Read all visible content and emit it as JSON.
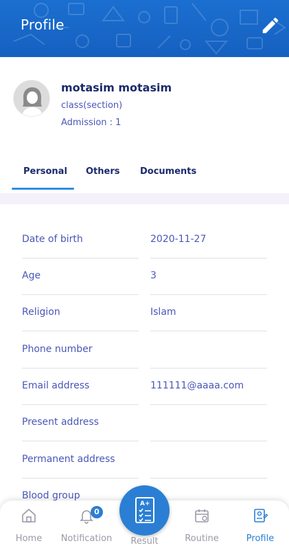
{
  "header": {
    "title": "Profile",
    "edit_icon": "pencil-icon"
  },
  "profile": {
    "name": "motasim motasim",
    "class_section": "class(section)",
    "admission": "Admission : 1"
  },
  "tabs": [
    {
      "label": "Personal",
      "active": true
    },
    {
      "label": "Others",
      "active": false
    },
    {
      "label": "Documents",
      "active": false
    }
  ],
  "details": [
    {
      "label": "Date of birth",
      "value": "2020-11-27"
    },
    {
      "label": "Age",
      "value": "3"
    },
    {
      "label": "Religion",
      "value": "Islam"
    },
    {
      "label": "Phone number",
      "value": ""
    },
    {
      "label": "Email address",
      "value": "111111@aaaa.com"
    },
    {
      "label": "Present address",
      "value": ""
    },
    {
      "label": "Permanent address",
      "value": ""
    },
    {
      "label": "Blood group",
      "value": ""
    }
  ],
  "bottom_nav": {
    "home": "Home",
    "notification": "Notification",
    "notification_count": "0",
    "result": "Result",
    "routine": "Routine",
    "profile": "Profile"
  },
  "colors": {
    "primary": "#1b6fd0",
    "accent": "#2a7fd4",
    "text_dark": "#1b2a6b",
    "text_label": "#4a56b8",
    "nav_inactive": "#9a9aa8"
  }
}
